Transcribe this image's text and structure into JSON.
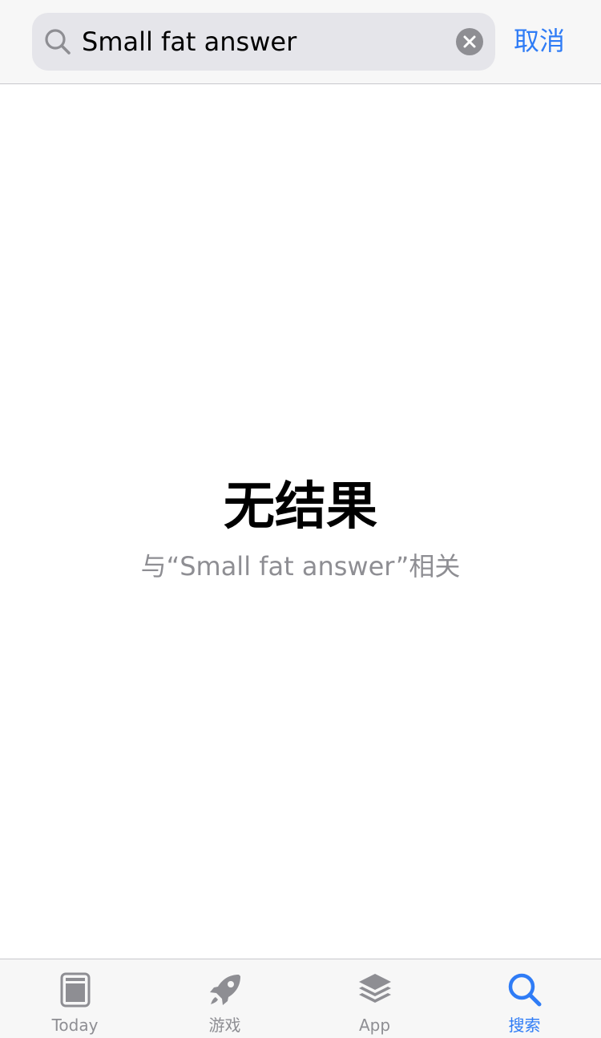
{
  "search": {
    "query": "Small fat answer",
    "cancel_label": "取消"
  },
  "empty_state": {
    "title": "无结果",
    "subtitle": "与“Small fat answer”相关"
  },
  "tab_bar": {
    "tabs": [
      {
        "label": "Today",
        "icon": "today-icon",
        "active": false
      },
      {
        "label": "游戏",
        "icon": "rocket-icon",
        "active": false
      },
      {
        "label": "App",
        "icon": "app-stack-icon",
        "active": false
      },
      {
        "label": "搜索",
        "icon": "search-icon",
        "active": true
      }
    ]
  },
  "colors": {
    "accent": "#2f7cf6",
    "inactive": "#8e8e93",
    "search_field_bg": "#e5e5ea",
    "bar_bg": "#f7f7f7"
  }
}
